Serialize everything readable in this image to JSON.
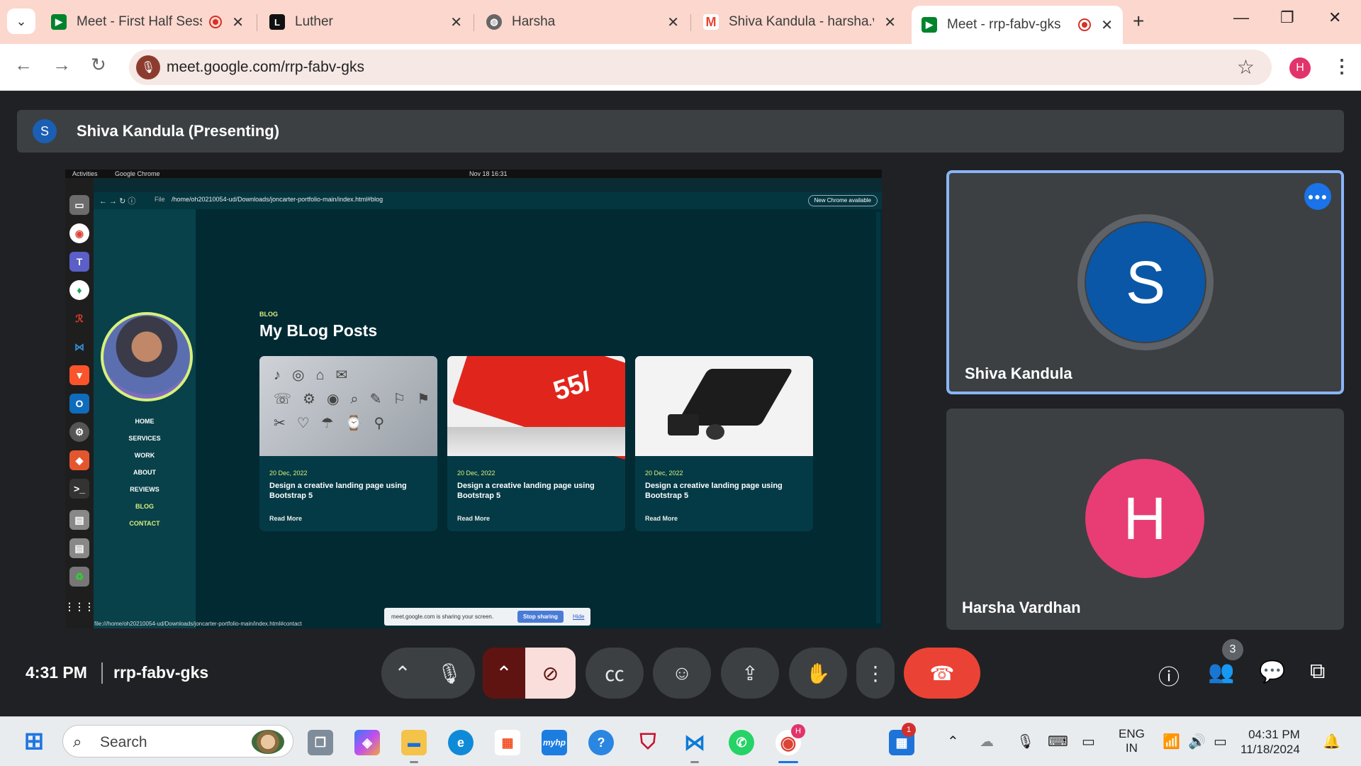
{
  "browser": {
    "tabs": [
      {
        "title": "Meet - First Half Sess",
        "recording": true
      },
      {
        "title": "Luther",
        "recording": false
      },
      {
        "title": "Harsha",
        "recording": false
      },
      {
        "title": "Shiva Kandula - harsha.va",
        "recording": false
      },
      {
        "title": "Meet - rrp-fabv-gks",
        "recording": true
      }
    ],
    "url": "meet.google.com/rrp-fabv-gks",
    "profile_initial": "H",
    "favicon_luther": "L"
  },
  "meet": {
    "presenting_initial": "S",
    "presenting_label": "Shiva Kandula (Presenting)",
    "participants": [
      {
        "initial": "S",
        "name": "Shiva Kandula",
        "color": "#0b57a7",
        "speaking": true
      },
      {
        "initial": "H",
        "name": "Harsha Vardhan",
        "color": "#e73d74",
        "speaking": false
      }
    ],
    "time": "4:31 PM",
    "meeting_code": "rrp-fabv-gks",
    "people_count": "3",
    "talking_indicator": "●●●"
  },
  "shared_screen": {
    "topbar_left": "Activities",
    "topbar_app": "Google Chrome",
    "topbar_clock": "Nov 18  16:31",
    "address": "/home/oh20210054-ud/Downloads/joncarter-portfolio-main/index.html#blog",
    "address_prefix": "File",
    "update_chip": "New Chrome available",
    "nav": [
      "HOME",
      "SERVICES",
      "WORK",
      "ABOUT",
      "REVIEWS",
      "BLOG",
      "CONTACT"
    ],
    "section_tag": "BLOG",
    "section_title": "My BLog Posts",
    "cards": [
      {
        "date": "20 Dec, 2022",
        "title": "Design a creative landing page using Bootstrap 5",
        "more": "Read More"
      },
      {
        "date": "20 Dec, 2022",
        "title": "Design a creative landing page using Bootstrap 5",
        "more": "Read More"
      },
      {
        "date": "20 Dec, 2022",
        "title": "Design a creative landing page using Bootstrap 5",
        "more": "Read More"
      }
    ],
    "card2_img_text": "55/",
    "share_notice": "meet.google.com is sharing your screen.",
    "stop_sharing": "Stop sharing",
    "hide": "Hide",
    "status_url": "file:///home/oh20210054-ud/Downloads/joncarter-portfolio-main/index.html#contact"
  },
  "taskbar": {
    "search_placeholder": "Search",
    "notification_badge": "1",
    "chrome_badge": "H",
    "lang_top": "ENG",
    "lang_bottom": "IN",
    "clock_time": "04:31 PM",
    "clock_date": "11/18/2024"
  },
  "colors": {
    "accent_blue": "#8ab4f8",
    "end_call": "#ea4335",
    "portfolio_highlight": "#d9f07a"
  }
}
